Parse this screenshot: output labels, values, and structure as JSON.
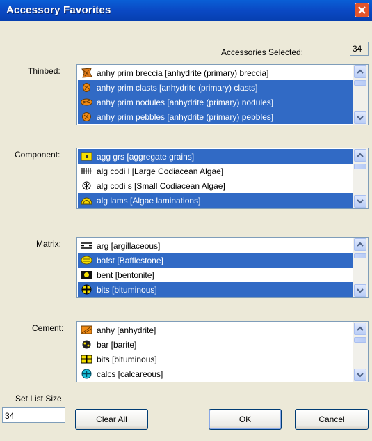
{
  "window": {
    "title": "Accessory Favorites"
  },
  "accessories_selected": {
    "label": "Accessories Selected:",
    "value": "34"
  },
  "lists": {
    "thinbed": {
      "label": "Thinbed:",
      "items": [
        {
          "text": "anhy prim breccia [anhydrite (primary) breccia]",
          "selected": false,
          "icon": "anhydrite-breccia-icon"
        },
        {
          "text": "anhy prim clasts [anhydrite (primary) clasts]",
          "selected": true,
          "icon": "anhydrite-clasts-icon"
        },
        {
          "text": "anhy prim nodules [anhydrite (primary) nodules]",
          "selected": true,
          "icon": "anhydrite-nodules-icon"
        },
        {
          "text": "anhy prim pebbles [anhydrite (primary) pebbles]",
          "selected": true,
          "icon": "anhydrite-pebbles-icon"
        }
      ]
    },
    "component": {
      "label": "Component:",
      "items": [
        {
          "text": "agg grs [aggregate grains]",
          "selected": true,
          "icon": "aggregate-grains-icon"
        },
        {
          "text": "alg codi l [Large Codiacean Algae]",
          "selected": false,
          "icon": "large-codiacean-algae-icon"
        },
        {
          "text": "alg codi s [Small Codiacean Algae]",
          "selected": false,
          "icon": "small-codiacean-algae-icon"
        },
        {
          "text": "alg lams [Algae laminations]",
          "selected": true,
          "icon": "algae-laminations-icon"
        }
      ]
    },
    "matrix": {
      "label": "Matrix:",
      "items": [
        {
          "text": "arg [argillaceous]",
          "selected": false,
          "icon": "argillaceous-icon"
        },
        {
          "text": "bafst [Bafflestone]",
          "selected": true,
          "icon": "bafflestone-icon"
        },
        {
          "text": "bent [bentonite]",
          "selected": false,
          "icon": "bentonite-icon"
        },
        {
          "text": "bits [bituminous]",
          "selected": true,
          "icon": "bituminous-icon"
        }
      ]
    },
    "cement": {
      "label": "Cement:",
      "items": [
        {
          "text": "anhy [anhydrite]",
          "selected": false,
          "icon": "anhydrite-icon"
        },
        {
          "text": "bar [barite]",
          "selected": false,
          "icon": "barite-icon"
        },
        {
          "text": "bits [bituminous]",
          "selected": false,
          "icon": "bituminous-icon"
        },
        {
          "text": "calcs [calcareous]",
          "selected": false,
          "icon": "calcareous-icon"
        }
      ]
    }
  },
  "set_list_size": {
    "label": "Set List Size",
    "value": "34"
  },
  "buttons": {
    "clear_all": "Clear All",
    "ok": "OK",
    "cancel": "Cancel"
  },
  "colors": {
    "selection": "#316ac5",
    "titlebar": "#0a5fd6",
    "dialog": "#ece9d8",
    "close": "#e3552c"
  }
}
